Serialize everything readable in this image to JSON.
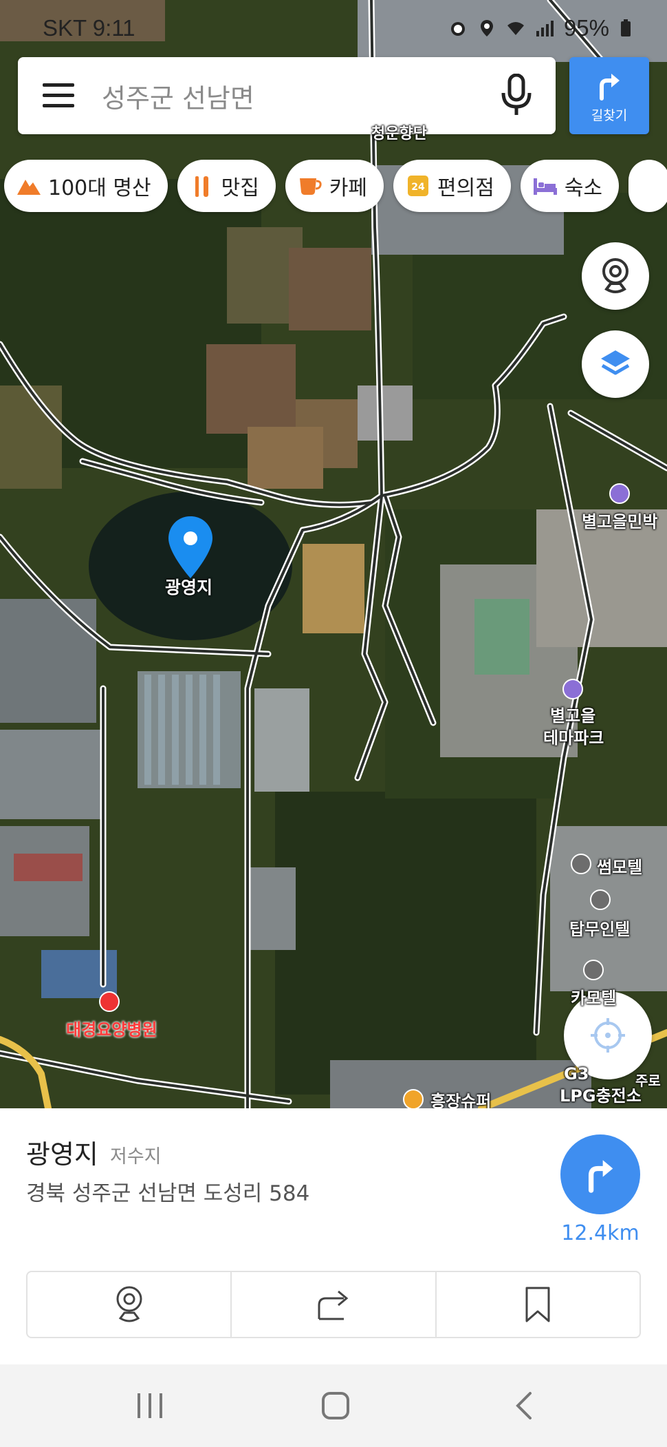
{
  "status": {
    "time": "SKT 9:11",
    "battery": "95%"
  },
  "search": {
    "text": "성주군 선남면"
  },
  "route_button": {
    "label": "길찾기"
  },
  "chips": [
    {
      "label": "100대 명산",
      "icon": "mountain-icon",
      "color": "#f07c2a"
    },
    {
      "label": "맛집",
      "icon": "restaurant-icon",
      "color": "#f07c2a"
    },
    {
      "label": "카페",
      "icon": "cafe-icon",
      "color": "#f07c2a"
    },
    {
      "label": "편의점",
      "icon": "convenience-store-icon",
      "color": "#f0b32a"
    },
    {
      "label": "숙소",
      "icon": "bed-icon",
      "color": "#8b6fd6"
    }
  ],
  "map": {
    "pin_label": "광영지",
    "labels": {
      "star_minbak": "별고을민박",
      "star_themepark_1": "별고을",
      "star_themepark_2": "테마파크",
      "motel_1": "썸모텔",
      "motel_2": "탑무인텔",
      "hospital": "대경요양병원",
      "store": "흥장슈퍼",
      "lpg": "LPG충전소",
      "top_label": "청운향단",
      "road_label": "주로",
      "gs": "G3",
      "motel_3": "카모텔"
    }
  },
  "place": {
    "name": "광영지",
    "category": "저수지",
    "address": "경북 성주군 선남면 도성리 584",
    "distance": "12.4km"
  },
  "colors": {
    "accent": "#3f8ef0"
  }
}
